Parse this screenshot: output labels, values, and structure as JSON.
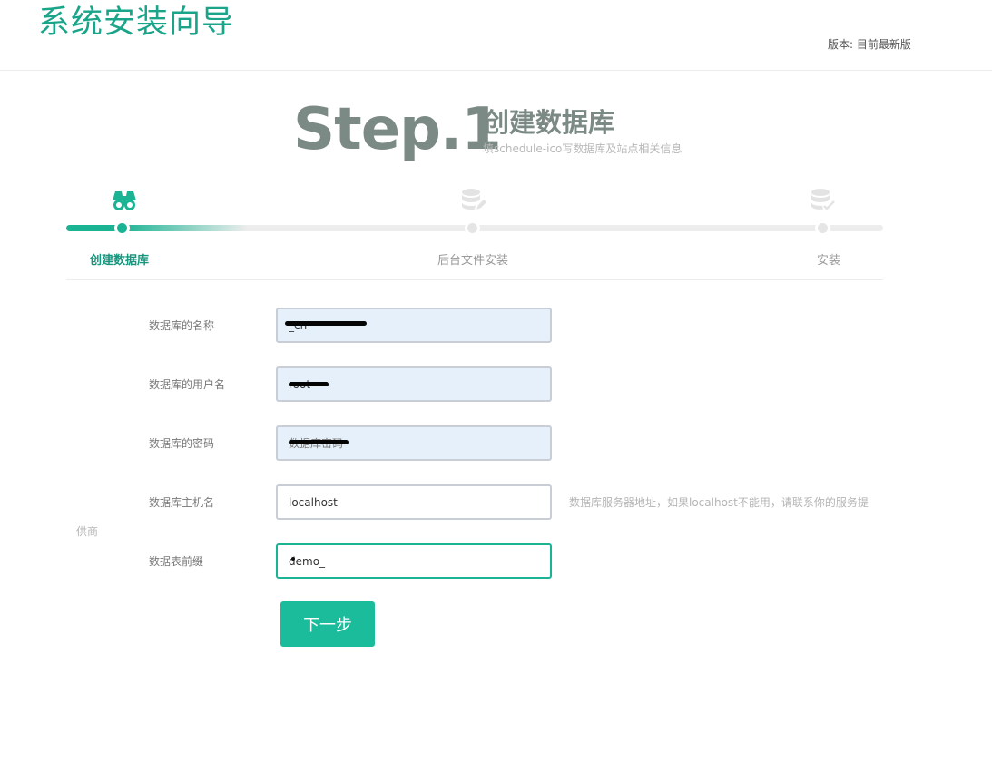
{
  "header": {
    "title": "系统安装向导",
    "version": "版本: 目前最新版"
  },
  "step_heading": {
    "number": "Step.1",
    "title": "创建数据库",
    "subtitle": "填schedule-ico写数据库及站点相关信息"
  },
  "progress": {
    "steps": [
      {
        "label": "创建数据库",
        "icon": "binoculars-icon",
        "state": "active"
      },
      {
        "label": "后台文件安装",
        "icon": "database-edit-icon",
        "state": "pending"
      },
      {
        "label": "安装",
        "icon": "database-check-icon",
        "state": "pending"
      }
    ]
  },
  "form": {
    "db_name": {
      "label": "数据库的名称",
      "value": "_cn"
    },
    "db_user": {
      "label": "数据库的用户名",
      "value": "root"
    },
    "db_password": {
      "label": "数据库的密码",
      "value": "数据库密码"
    },
    "db_host": {
      "label": "数据库主机名",
      "value": "localhost",
      "hint": "数据库服务器地址，如果localhost不能用，请联系你的服务提",
      "hint_wrap": "供商"
    },
    "table_prefix": {
      "label": "数据表前缀",
      "value": "demo_"
    }
  },
  "actions": {
    "next_label": "下一步"
  },
  "colors": {
    "accent": "#1abc9c",
    "accent_dark": "#17967e",
    "title_green": "#1aa58a",
    "heading_gray": "#7c8a86"
  }
}
